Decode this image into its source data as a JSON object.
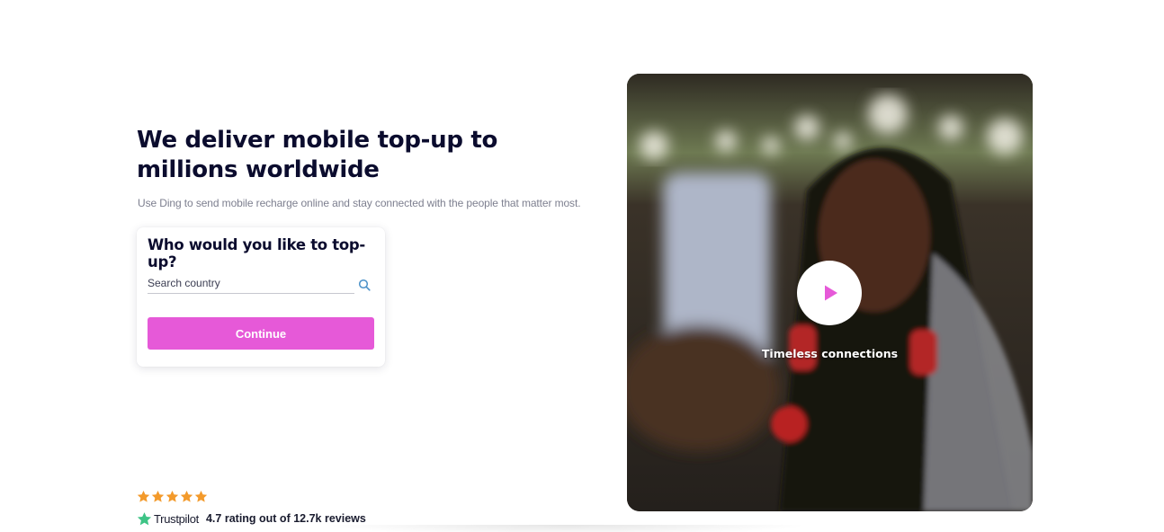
{
  "hero": {
    "title": "We deliver mobile top-up to millions worldwide",
    "subtitle": "Use Ding to send mobile recharge online and stay connected with the people that matter most."
  },
  "topup_card": {
    "title": "Who would you like to top-up?",
    "search": {
      "placeholder": "Search country",
      "value": "",
      "icon": "search-icon"
    },
    "continue_label": "Continue"
  },
  "rating": {
    "stars": 5,
    "brand": "Trustpilot",
    "summary": "4.7 rating out of 12.7k reviews"
  },
  "video": {
    "caption": "Timeless connections",
    "play_icon": "play-icon"
  },
  "colors": {
    "accent": "#e659d8",
    "heading": "#0b0c2e",
    "star": "#f39a2b",
    "trustpilot_green": "#3ec486",
    "search_icon": "#4a90c8"
  }
}
